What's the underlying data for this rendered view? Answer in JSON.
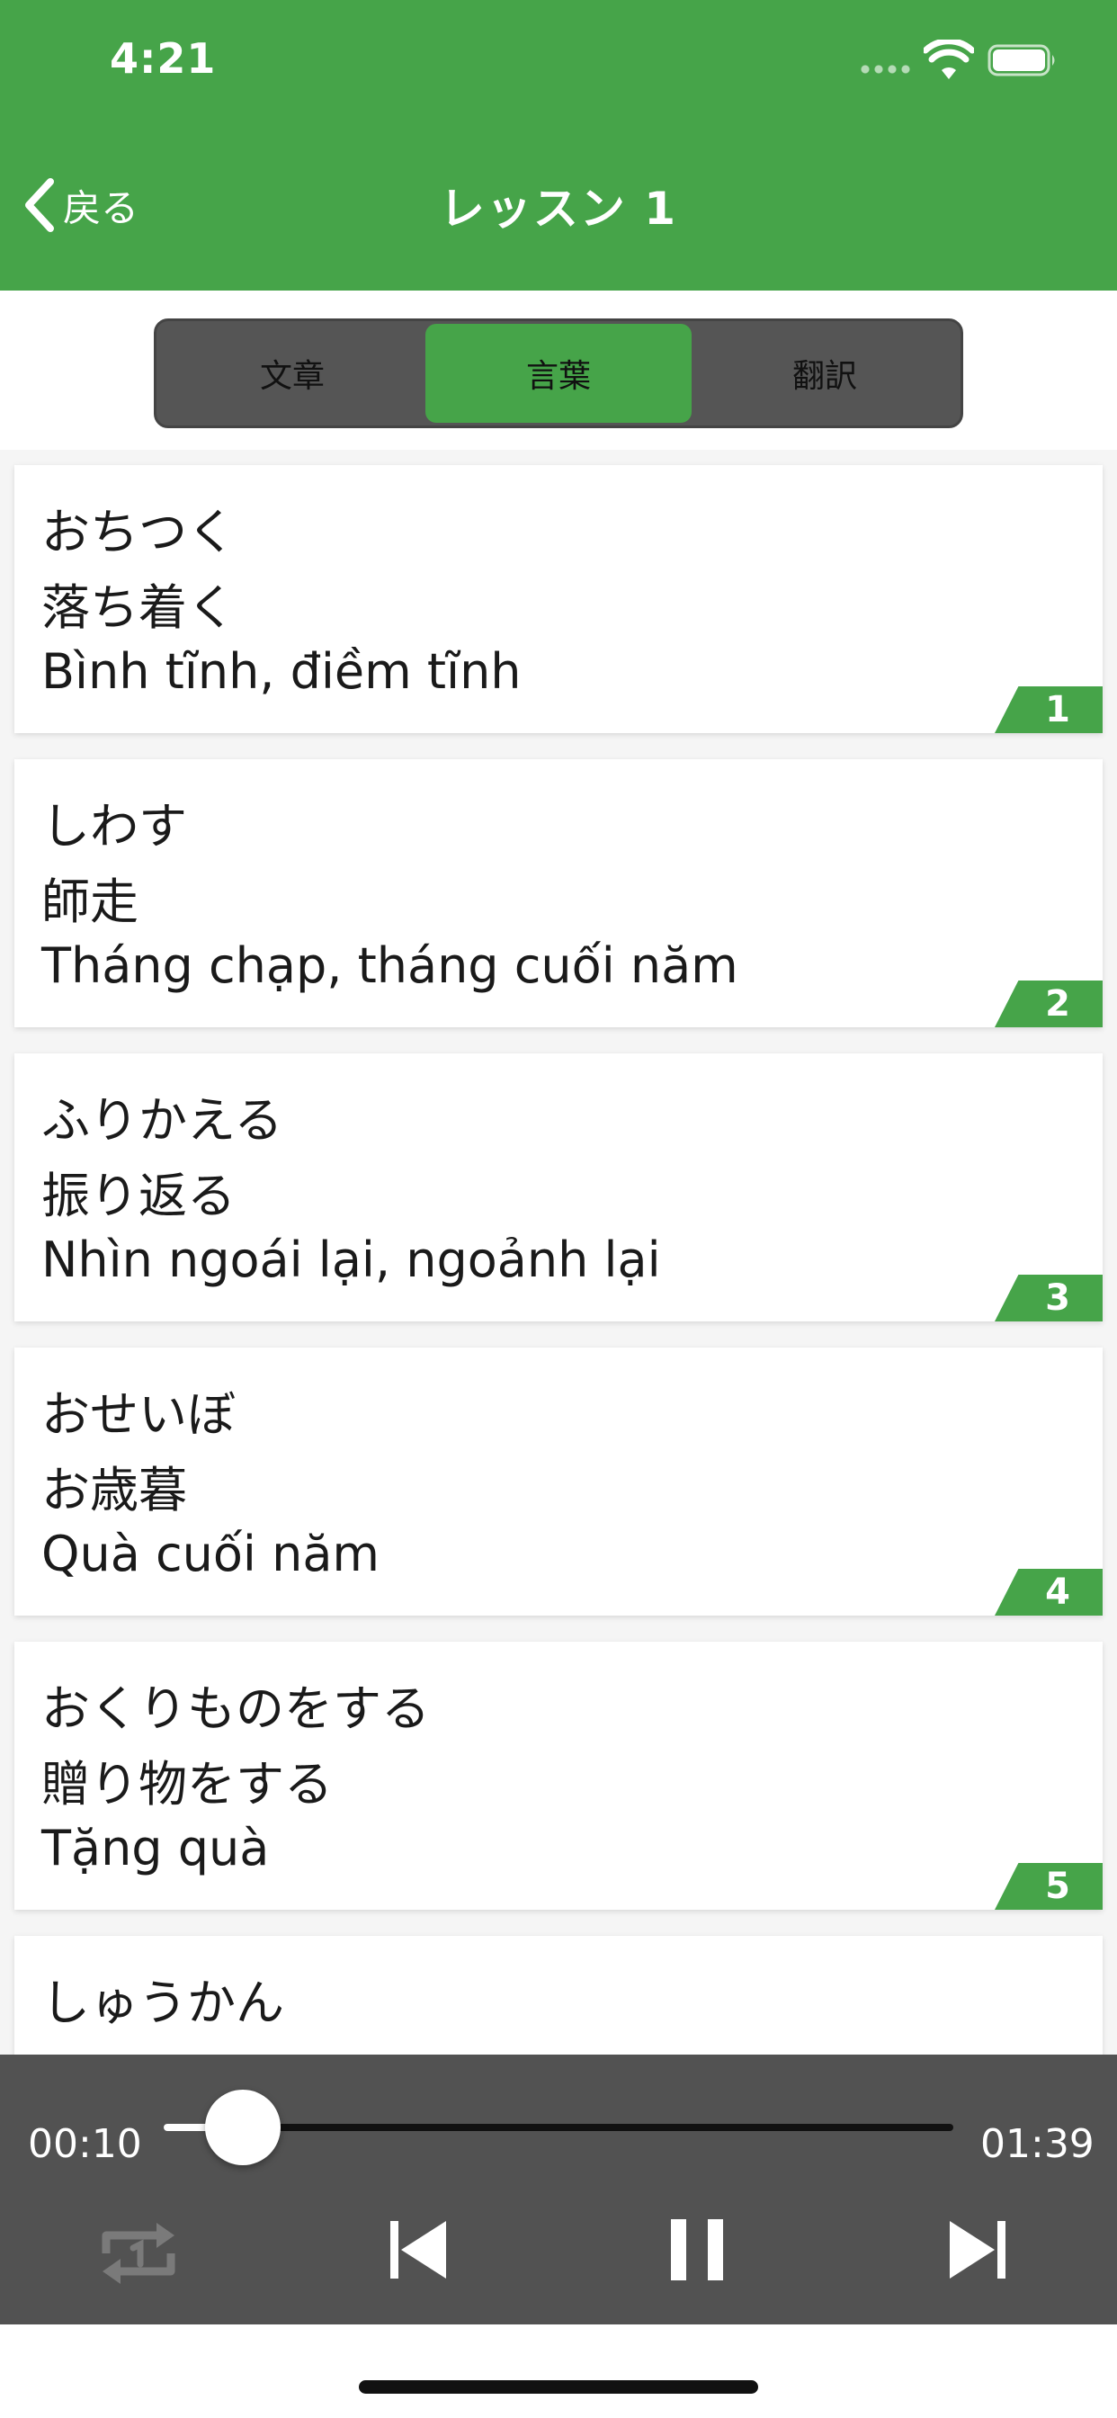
{
  "status_bar": {
    "time": "4:21"
  },
  "nav": {
    "back_label": "戻る",
    "title": "レッスン 1"
  },
  "tabs": [
    {
      "label": "文章",
      "active": false
    },
    {
      "label": "言葉",
      "active": true
    },
    {
      "label": "翻訳",
      "active": false
    }
  ],
  "vocab": [
    {
      "reading": "おちつく",
      "kanji": "落ち着く",
      "meaning": "Bình tĩnh, điềm tĩnh",
      "number": "1"
    },
    {
      "reading": "しわす",
      "kanji": "師走",
      "meaning": "Tháng chạp, tháng cuối năm",
      "number": "2"
    },
    {
      "reading": "ふりかえる",
      "kanji": "振り返る",
      "meaning": "Nhìn ngoái lại, ngoảnh lại",
      "number": "3"
    },
    {
      "reading": "おせいぼ",
      "kanji": "お歳暮",
      "meaning": "Quà cuối năm",
      "number": "4"
    },
    {
      "reading": "おくりものをする",
      "kanji": "贈り物をする",
      "meaning": "Tặng quà",
      "number": "5"
    },
    {
      "reading": "しゅうかん",
      "kanji": "",
      "meaning": "",
      "number": ""
    }
  ],
  "player": {
    "current_time": "00:10",
    "total_time": "01:39",
    "progress": 0.1,
    "controls": [
      "repeat-one-icon",
      "skip-previous-icon",
      "pause-icon",
      "skip-next-icon"
    ]
  },
  "colors": {
    "primary": "#46a449",
    "player_bg": "#525252",
    "segment_bg": "#555555"
  }
}
